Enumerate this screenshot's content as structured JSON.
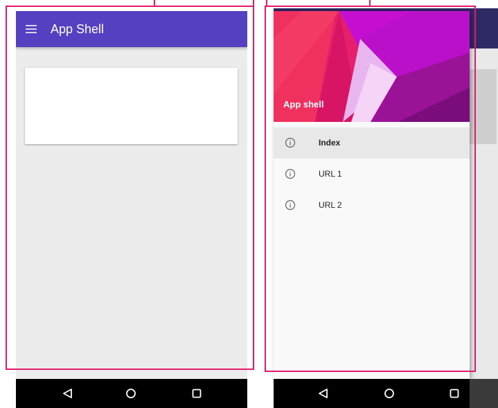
{
  "left_phone": {
    "app_title": "App Shell",
    "menu_icon": "menu-icon"
  },
  "right_phone": {
    "drawer_title": "App shell",
    "menu_items": [
      {
        "label": "Index",
        "icon": "info-icon",
        "active": true
      },
      {
        "label": "URL 1",
        "icon": "info-icon",
        "active": false
      },
      {
        "label": "URL 2",
        "icon": "info-icon",
        "active": false
      }
    ]
  },
  "nav_bar": {
    "buttons": [
      "back-icon",
      "home-icon",
      "recents-icon"
    ]
  },
  "colors": {
    "highlight_border": "#e2196d",
    "app_bar": "#5540c2",
    "drawer_header_primary": "#e51f6c",
    "drawer_header_secondary": "#c40fd0"
  }
}
